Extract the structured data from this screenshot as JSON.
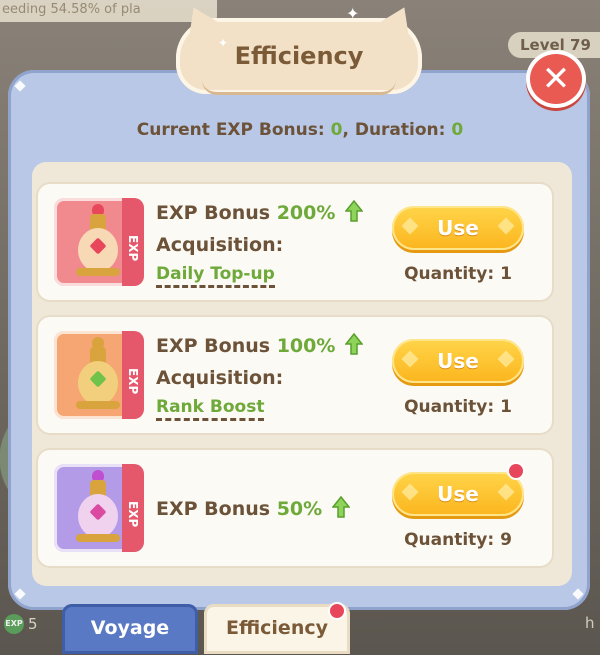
{
  "background": {
    "banner_text": "eeding 54.58% of pla",
    "level_label": "Level 79",
    "exp_value": "5",
    "right_text": "h"
  },
  "dialog": {
    "title": "Efficiency",
    "close_icon": "close-icon",
    "bonus_label_prefix": "Current EXP Bonus: ",
    "bonus_value": "0",
    "duration_label": ", Duration: ",
    "duration_value": "0"
  },
  "items": [
    {
      "tag": "EXP",
      "bonus_label": "EXP Bonus ",
      "bonus_pct": "200%",
      "acquisition_label": "Acquisition:",
      "acquisition_link": "Daily Top-up",
      "use_label": "Use",
      "quantity": "Quantity: 1",
      "tile_color": "#f08a8e",
      "has_red_dot": false
    },
    {
      "tag": "EXP",
      "bonus_label": "EXP Bonus ",
      "bonus_pct": "100%",
      "acquisition_label": "Acquisition:",
      "acquisition_link": "Rank Boost",
      "use_label": "Use",
      "quantity": "Quantity: 1",
      "tile_color": "#f6a673",
      "has_red_dot": false
    },
    {
      "tag": "EXP",
      "bonus_label": "EXP Bonus ",
      "bonus_pct": "50%",
      "use_label": "Use",
      "quantity": "Quantity: 9",
      "tile_color": "#b49be8",
      "has_red_dot": true
    }
  ],
  "tabs": [
    {
      "label": "Voyage",
      "active": false
    },
    {
      "label": "Efficiency",
      "active": true
    }
  ],
  "colors": {
    "accent_green": "#6ea93a",
    "button_yellow": "#fbb51e",
    "close_red": "#e85a52",
    "panel_blue": "#b9c8e6"
  }
}
